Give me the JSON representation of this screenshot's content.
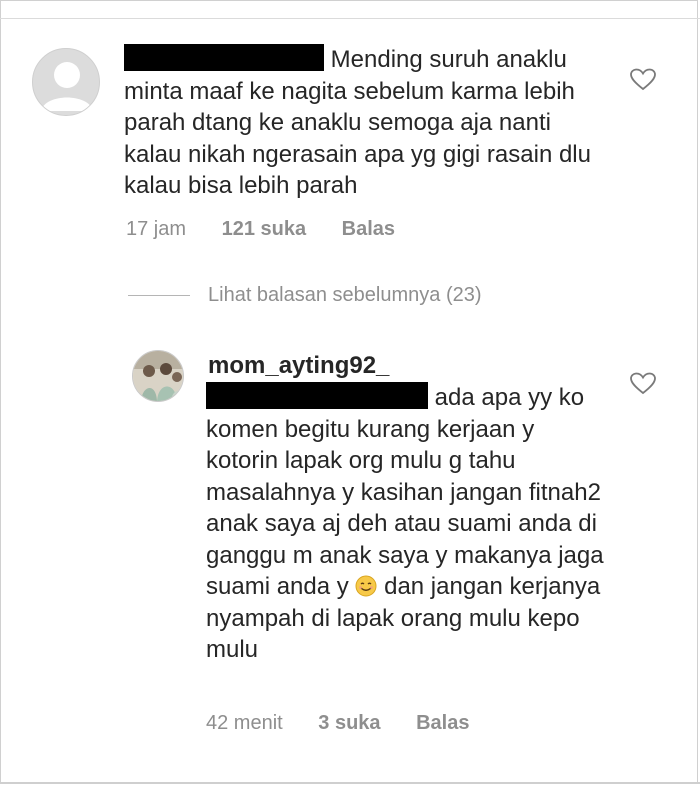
{
  "comment1": {
    "text_first": "Mending suruh anaklu",
    "text_rest": "minta maaf ke nagita sebelum karma lebih parah dtang ke anaklu semoga aja nanti kalau nikah ngerasain apa yg gigi rasain dlu kalau bisa lebih parah",
    "time": "17 jam",
    "likes": "121 suka",
    "reply": "Balas",
    "like_icon": "heart-outline-icon"
  },
  "view_replies": {
    "label": "Lihat balasan sebelumnya (23)"
  },
  "reply1": {
    "username": "mom_ayting92_",
    "text_first": "ada apa yy ko",
    "text_mid": "komen begitu kurang kerjaan y kotorin lapak org mulu g tahu masalahnya y kasihan jangan fitnah2 anak saya aj deh atau suami anda di ganggu m anak saya y makanya jaga suami anda y",
    "text_after_emoji": "dan jangan kerjanya nyampah di lapak orang mulu kepo mulu",
    "emoji_icon": "smiling-face-emoji-icon",
    "time": "42 menit",
    "likes": "3 suka",
    "reply": "Balas",
    "like_icon": "heart-outline-icon"
  }
}
